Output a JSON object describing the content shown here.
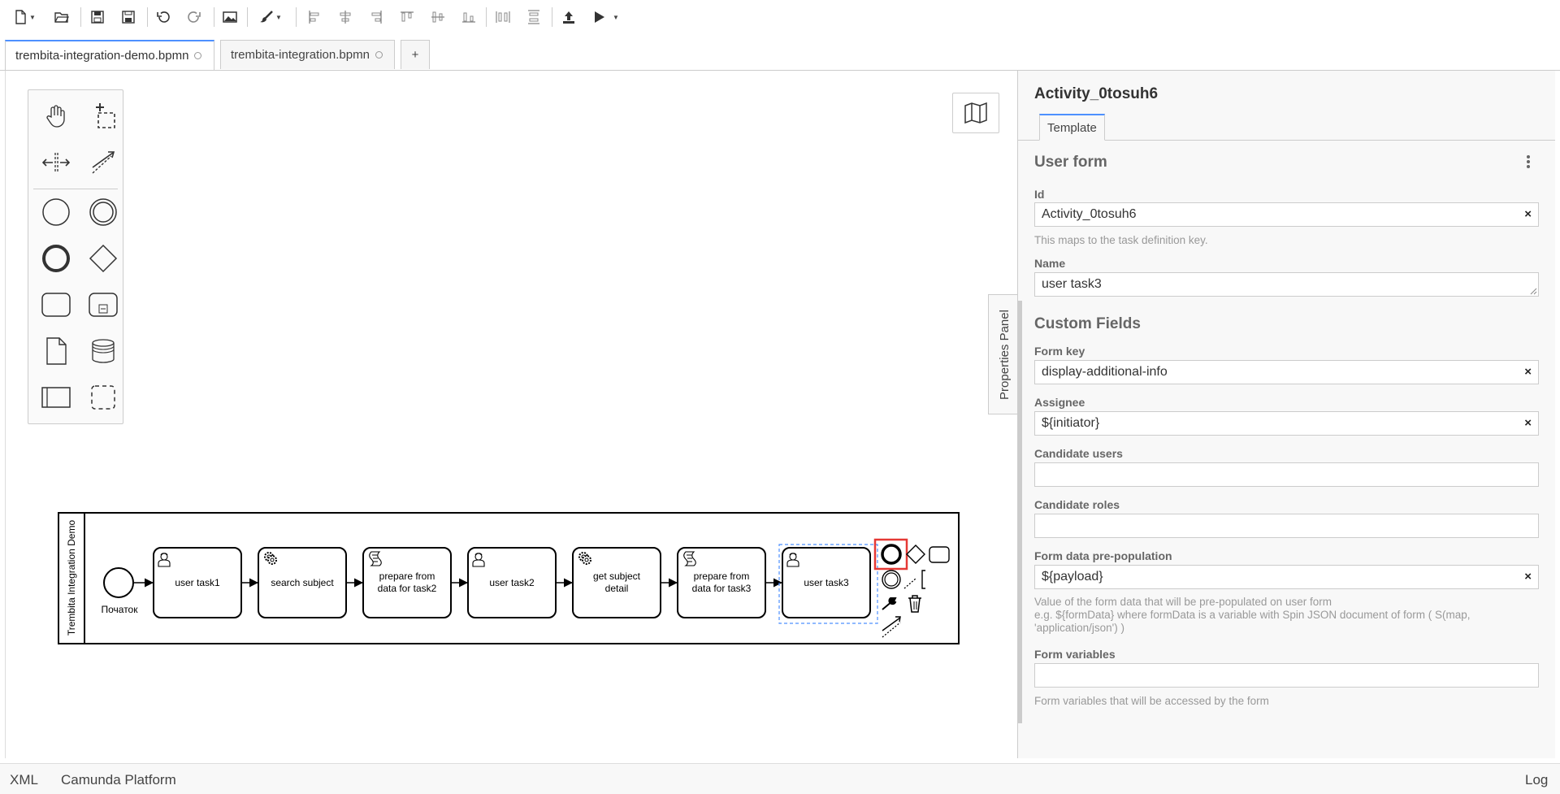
{
  "toolbar": {
    "items": [
      "new-file-icon",
      "open-folder-icon",
      "save-icon",
      "save-as-icon",
      "undo-icon",
      "redo-icon",
      "export-image-icon",
      "color-brush-icon",
      "align-left-icon",
      "align-center-icon",
      "align-right-icon",
      "align-top-icon",
      "align-middle-icon",
      "align-bottom-icon",
      "distribute-horizontal-icon",
      "distribute-vertical-icon",
      "deploy-icon",
      "run-icon"
    ]
  },
  "tabs": [
    {
      "label": "trembita-integration-demo.bpmn",
      "active": true
    },
    {
      "label": "trembita-integration.bpmn",
      "active": false
    },
    {
      "label": "+"
    }
  ],
  "palette": {
    "tools": [
      "hand-tool-icon",
      "lasso-tool-icon",
      "space-tool-icon",
      "global-connect-icon"
    ],
    "elements": [
      "start-event-icon",
      "intermediate-event-icon",
      "end-event-icon",
      "gateway-icon",
      "task-icon",
      "subprocess-icon",
      "data-object-icon",
      "data-store-icon",
      "pool-icon",
      "group-icon"
    ]
  },
  "diagram": {
    "pool_label": "Trembita Integration Demo",
    "start_event_label": "Початок",
    "tasks": [
      {
        "label1": "user task1",
        "label2": "",
        "icon": "user-icon"
      },
      {
        "label1": "search subject",
        "label2": "",
        "icon": "service-gear-icon"
      },
      {
        "label1": "prepare from",
        "label2": "data for task2",
        "icon": "script-icon"
      },
      {
        "label1": "user task2",
        "label2": "",
        "icon": "user-icon"
      },
      {
        "label1": "get subject",
        "label2": "detail",
        "icon": "service-gear-icon"
      },
      {
        "label1": "prepare from",
        "label2": "data for task3",
        "icon": "script-icon"
      },
      {
        "label1": "user task3",
        "label2": "",
        "icon": "user-icon",
        "selected": true
      }
    ]
  },
  "properties": {
    "toggle_label": "Properties Panel",
    "title": "Activity_0tosuh6",
    "tab": "Template",
    "group1": "User form",
    "id_label": "Id",
    "id_value": "Activity_0tosuh6",
    "id_desc": "This maps to the task definition key.",
    "name_label": "Name",
    "name_value": "user task3",
    "group2": "Custom Fields",
    "formkey_label": "Form key",
    "formkey_value": "display-additional-info",
    "assignee_label": "Assignee",
    "assignee_value": "${initiator}",
    "cand_users_label": "Candidate users",
    "cand_users_value": "",
    "cand_roles_label": "Candidate roles",
    "cand_roles_value": "",
    "prepop_label": "Form data pre-population",
    "prepop_value": "${payload}",
    "prepop_desc1": "Value of the form data that will be pre-populated on user form",
    "prepop_desc2": "e.g. ${formData} where formData is a variable with Spin JSON document of form ( S(map,",
    "prepop_desc3": "'application/json') )",
    "formvars_label": "Form variables",
    "formvars_value": "",
    "formvars_desc": "Form variables that will be accessed by the form",
    "clear": "×"
  },
  "footer": {
    "xml": "XML",
    "platform": "Camunda Platform",
    "log": "Log"
  }
}
